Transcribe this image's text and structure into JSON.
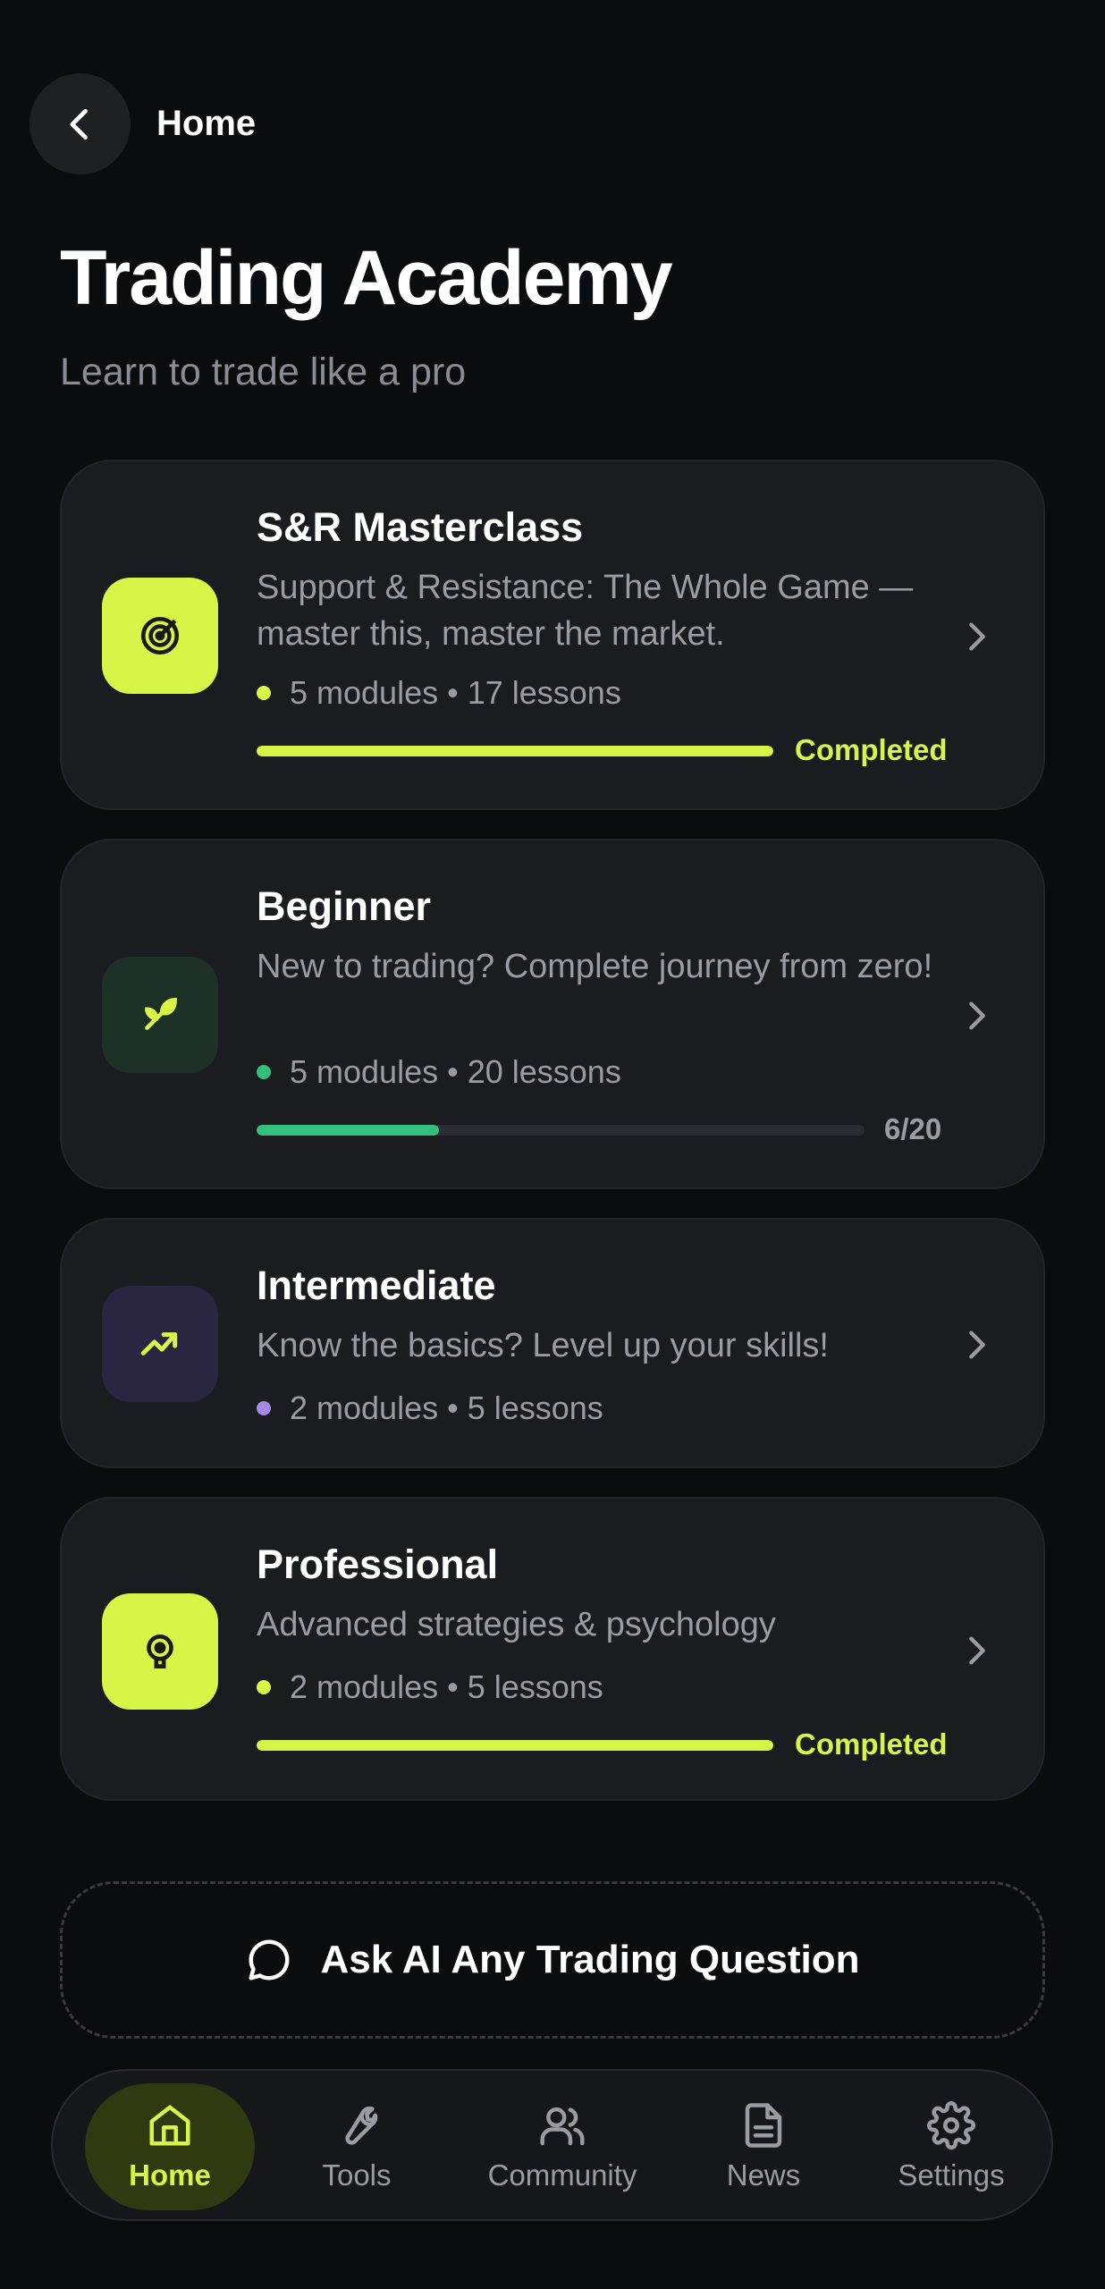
{
  "header": {
    "back_label": "Home"
  },
  "page": {
    "title": "Trading Academy",
    "subtitle": "Learn to trade like a pro"
  },
  "colors": {
    "accent": "#d8f547",
    "beginner": "#33c07a",
    "intermediate": "#a48ae6",
    "background": "#0b0c0e",
    "card": "#1b1c20"
  },
  "courses": [
    {
      "title": "S&R Masterclass",
      "description": "Support & Resistance: The Whole Game — master this, master the market.",
      "modules": "5 modules",
      "lessons": "17 lessons",
      "icon": "target-icon",
      "progress_label": "Completed",
      "progress": 1.0
    },
    {
      "title": "Beginner",
      "description": "New to trading? Complete journey from zero!",
      "modules": "5 modules",
      "lessons": "20 lessons",
      "icon": "seedling-icon",
      "progress_label": "6/20",
      "progress": 0.3
    },
    {
      "title": "Intermediate",
      "description": "Know the basics? Level up your skills!",
      "modules": "2 modules",
      "lessons": "5 lessons",
      "icon": "chart-up-icon"
    },
    {
      "title": "Professional",
      "description": "Advanced strategies & psychology",
      "modules": "2 modules",
      "lessons": "5 lessons",
      "icon": "brain-icon",
      "progress_label": "Completed",
      "progress": 1.0
    }
  ],
  "ask_ai": {
    "label": "Ask AI Any Trading Question"
  },
  "nav": {
    "items": [
      {
        "label": "Home",
        "icon": "home-icon",
        "active": true
      },
      {
        "label": "Tools",
        "icon": "wrench-icon"
      },
      {
        "label": "Community",
        "icon": "users-icon"
      },
      {
        "label": "News",
        "icon": "document-icon"
      },
      {
        "label": "Settings",
        "icon": "gear-icon"
      }
    ]
  }
}
